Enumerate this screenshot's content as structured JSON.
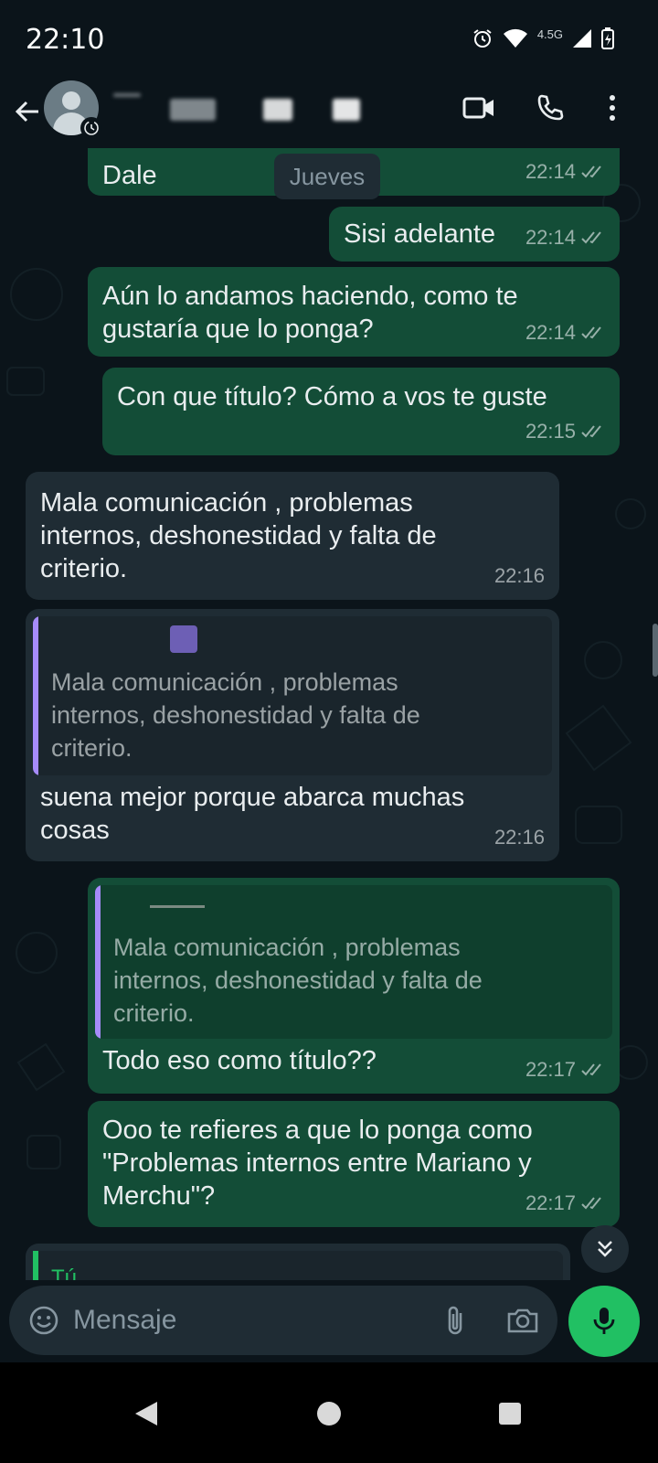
{
  "status_bar": {
    "time": "22:10",
    "network": "4.5G",
    "icons": [
      "alarm-icon",
      "wifi-icon",
      "signal-icon",
      "battery-icon"
    ]
  },
  "header": {
    "icons": [
      "back-arrow-icon",
      "avatar",
      "disappearing-timer-icon",
      "video-call-icon",
      "voice-call-icon",
      "more-options-icon"
    ]
  },
  "chat": {
    "date_chip": "Jueves",
    "messages": [
      {
        "dir": "out",
        "text": "Dale",
        "time": "22:14"
      },
      {
        "dir": "out",
        "text": "Sisi adelante",
        "time": "22:14"
      },
      {
        "dir": "out",
        "text": "Aún lo andamos haciendo, como te\ngustaría que lo ponga?",
        "time": "22:14"
      },
      {
        "dir": "out",
        "text": "Con que título? Cómo a vos te guste",
        "time": "22:15"
      },
      {
        "dir": "in",
        "text": "Mala comunicación , problemas\ninternos, deshonestidad y falta de\ncriterio.",
        "time": "22:16"
      },
      {
        "dir": "in",
        "quoted": "Mala comunicación , problemas\ninternos, deshonestidad y falta de\ncriterio.",
        "text": "suena mejor porque abarca muchas\ncosas",
        "time": "22:16"
      },
      {
        "dir": "out",
        "quoted": "Mala comunicación , problemas\ninternos, deshonestidad y falta de\ncriterio.",
        "text": "Todo eso como título??",
        "time": "22:17"
      },
      {
        "dir": "out",
        "text": "Ooo te refieres a que lo ponga como\n\"Problemas internos entre Mariano y\nMerchu\"?",
        "time": "22:17"
      }
    ],
    "partial_reply_author": "Tú"
  },
  "input": {
    "placeholder": "Mensaje"
  },
  "colors": {
    "background": "#0b141a",
    "outgoing_bubble": "#134d37",
    "incoming_bubble": "#1f2c34",
    "accent_green": "#21c063",
    "quote_purple": "#a68bfa"
  }
}
